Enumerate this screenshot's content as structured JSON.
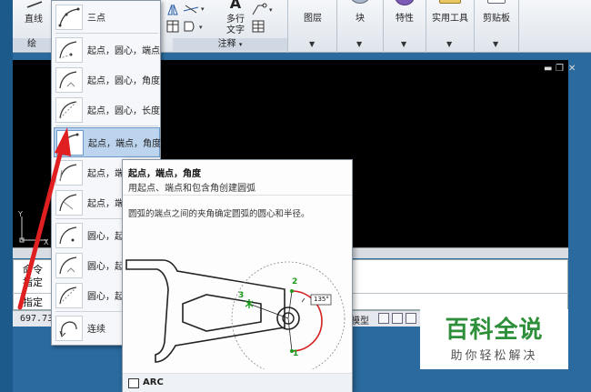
{
  "ribbon": {
    "line_label": "直线",
    "draw_panel_label": "绘",
    "multiline_text_label_1": "多行",
    "multiline_text_label_2": "文字",
    "annotation_panel_label": "注释",
    "layers_label": "图层",
    "block_label": "块",
    "properties_label": "特性",
    "utilities_label": "实用工具",
    "clipboard_label": "剪贴板",
    "text_icon_glyph": "A"
  },
  "arc_menu": {
    "items": [
      {
        "label": "三点"
      },
      {
        "label": "起点，圆心，端点"
      },
      {
        "label": "起点，圆心，角度"
      },
      {
        "label": "起点，圆心，长度"
      },
      {
        "label": "起点，端点，角度"
      },
      {
        "label": "起点，端"
      },
      {
        "label": "起点，端"
      },
      {
        "label": "圆心，起"
      },
      {
        "label": "圆心，起"
      },
      {
        "label": "圆心，起"
      },
      {
        "label": "连续"
      }
    ],
    "active_index": 4
  },
  "tooltip": {
    "title": "起点，端点，角度",
    "subtitle": "用起点、端点和包含角创建圆弧",
    "description": "圆弧的端点之间的夹角确定圆弧的圆心和半径。",
    "angle_label": "135°",
    "point_1": "1",
    "point_2": "2",
    "point_3": "3",
    "command_name": "ARC"
  },
  "canvas": {
    "ucs_y": "Y",
    "ucs_x": "X"
  },
  "command": {
    "line1": "命令",
    "line2": "指定",
    "line3": "指定"
  },
  "status_bar": {
    "coordinates": "697.732",
    "model_label": "模型"
  },
  "watermark": {
    "title": "百科全说",
    "subtitle": "助你轻松解决"
  },
  "colors": {
    "canvas_bg": "#000000",
    "menu_active": "#bcd4ee",
    "arc_red": "#d42020",
    "point_green": "#1a9a1a",
    "arrow_red": "#e02020",
    "watermark_green": "#2e8f3a"
  }
}
